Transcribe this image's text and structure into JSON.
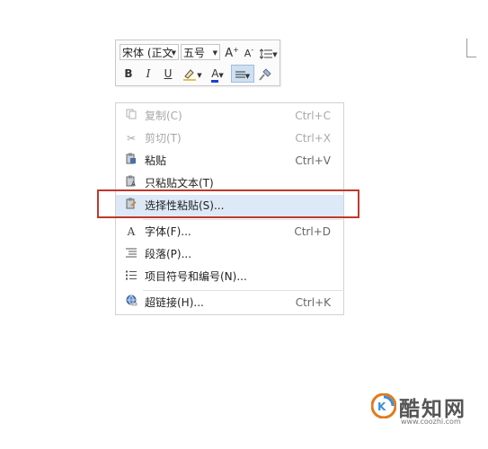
{
  "toolbar": {
    "font_name": "宋体 (正文",
    "font_size": "五号",
    "grow_font": "A",
    "shrink_font": "A",
    "bold": "B",
    "italic": "I",
    "underline": "U",
    "font_color": "A"
  },
  "menu": {
    "items": [
      {
        "label": "复制(C)",
        "shortcut": "Ctrl+C",
        "icon": "copy-icon",
        "disabled": true
      },
      {
        "label": "剪切(T)",
        "shortcut": "Ctrl+X",
        "icon": "scissors-icon",
        "disabled": true
      },
      {
        "label": "粘贴",
        "shortcut": "Ctrl+V",
        "icon": "paste-icon",
        "disabled": false
      },
      {
        "label": "只粘贴文本(T)",
        "shortcut": "",
        "icon": "paste-text-icon",
        "disabled": false
      },
      {
        "label": "选择性粘贴(S)...",
        "shortcut": "",
        "icon": "paste-special-icon",
        "disabled": false
      },
      {
        "label": "字体(F)...",
        "shortcut": "Ctrl+D",
        "icon": "font-icon",
        "disabled": false
      },
      {
        "label": "段落(P)...",
        "shortcut": "",
        "icon": "paragraph-icon",
        "disabled": false
      },
      {
        "label": "项目符号和编号(N)...",
        "shortcut": "",
        "icon": "bullet-list-icon",
        "disabled": false
      },
      {
        "label": "超链接(H)...",
        "shortcut": "Ctrl+K",
        "icon": "hyperlink-icon",
        "disabled": false
      }
    ]
  },
  "colors": {
    "highlight_border": "#c0392b",
    "menu_hover": "#dde9f7",
    "font_color_bar": "#1f3fd0"
  },
  "watermark": {
    "name": "酷知网",
    "url": "www.coozhi.com"
  }
}
